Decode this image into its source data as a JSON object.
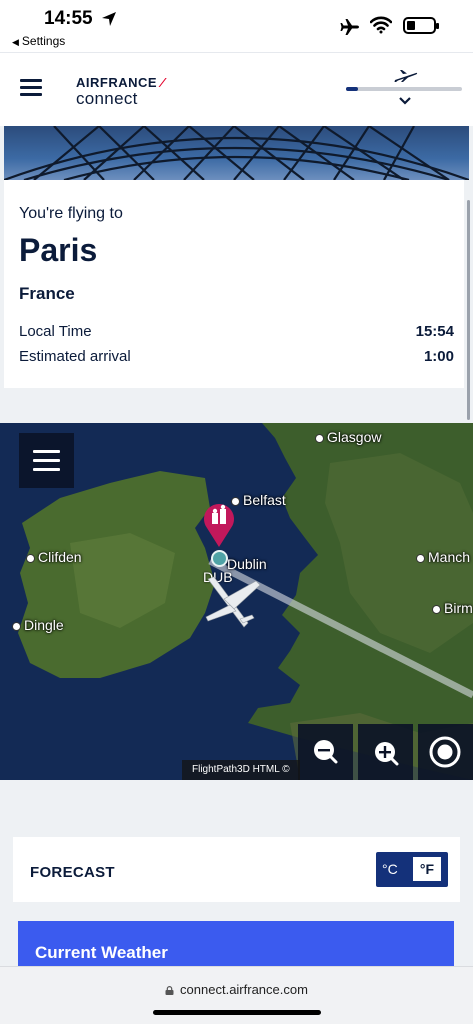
{
  "status_bar": {
    "time": "14:55",
    "back_app": "Settings",
    "battery_level": 0.3
  },
  "header": {
    "brand_name": "AIRFRANCE",
    "brand_suffix": "connect",
    "flight_progress": 0.1
  },
  "destination": {
    "intro": "You're flying to",
    "city": "Paris",
    "country": "France",
    "local_time_label": "Local Time",
    "local_time_value": "15:54",
    "arrival_label": "Estimated arrival",
    "arrival_value": "1:00"
  },
  "map": {
    "cities": {
      "glasgow": "Glasgow",
      "belfast": "Belfast",
      "clifden": "Clifden",
      "dublin": "Dublin",
      "dingle": "Dingle",
      "manchester": "Manch",
      "birmingham": "Birm"
    },
    "airport_code": "DUB",
    "credit": "FlightPath3D HTML ©",
    "route_color": "#d9dde3",
    "pin_color": "#c2185b"
  },
  "forecast": {
    "title": "FORECAST",
    "unit_c": "°C",
    "unit_f": "°F",
    "selected_unit": "°F"
  },
  "weather": {
    "title": "Current Weather"
  },
  "browser": {
    "url": "connect.airfrance.com"
  },
  "colors": {
    "brand_navy": "#0b1b3a",
    "accent_blue": "#14317a",
    "weather_blue": "#3b5bef",
    "airfrance_red": "#e4002b"
  }
}
